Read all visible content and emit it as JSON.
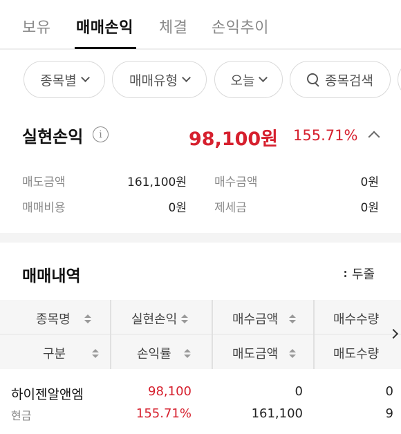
{
  "tabs": [
    {
      "label": "보유"
    },
    {
      "label": "매매손익"
    },
    {
      "label": "체결"
    },
    {
      "label": "손익추이"
    }
  ],
  "filters": {
    "by_stock": "종목별",
    "trade_type": "매매유형",
    "period": "오늘",
    "search": "종목검색"
  },
  "realized": {
    "title": "실현손익",
    "info": "i",
    "amount": "98,100원",
    "rate": "155.71%"
  },
  "summary": {
    "sell_amount_label": "매도금액",
    "sell_amount_value": "161,100원",
    "buy_amount_label": "매수금액",
    "buy_amount_value": "0원",
    "trade_cost_label": "매매비용",
    "trade_cost_value": "0원",
    "tax_label": "제세금",
    "tax_value": "0원"
  },
  "trades": {
    "title": "매매내역",
    "fold_label": "두줄",
    "headers_row1": [
      "종목명",
      "실현손익",
      "매수금액",
      "매수수량"
    ],
    "headers_row2": [
      "구분",
      "손익률",
      "매도금액",
      "매도수량"
    ],
    "rows": [
      {
        "name": "하이젠알앤엠",
        "category": "현금",
        "realized_pnl": "98,100",
        "pnl_rate": "155.71%",
        "buy_amount": "0",
        "sell_amount": "161,100",
        "buy_qty": "0",
        "sell_qty": "9"
      }
    ]
  },
  "colors": {
    "accent_red": "#d6202e",
    "text_dark": "#111111",
    "text_muted": "#8a8a8a"
  }
}
